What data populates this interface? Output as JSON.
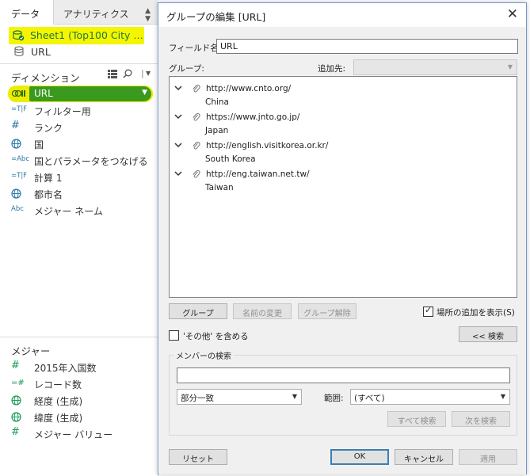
{
  "left_pane": {
    "tab_data": "データ",
    "tab_analytics": "アナリティクス",
    "datasources": [
      {
        "label": "Sheet1 (Top100 City …"
      },
      {
        "label": "URL"
      }
    ],
    "dimensions_header": "ディメンション",
    "dimensions": [
      {
        "icon": "url-field-icon",
        "label": "URL"
      },
      {
        "icon": "calculated-string-icon",
        "label": "フィルター用"
      },
      {
        "icon": "hash-icon",
        "label": "ランク"
      },
      {
        "icon": "globe-icon",
        "label": "国"
      },
      {
        "icon": "calculated-abc-icon",
        "label": "国とパラメータをつなげる"
      },
      {
        "icon": "calculated-string-icon",
        "label": "計算 1"
      },
      {
        "icon": "globe-icon",
        "label": "都市名"
      },
      {
        "icon": "abc-icon",
        "label": "メジャー ネーム"
      }
    ],
    "measures_header": "メジャー",
    "measures": [
      {
        "icon": "hash-icon",
        "label": "2015年入国数"
      },
      {
        "icon": "calculated-number-icon",
        "label": "レコード数"
      },
      {
        "icon": "globe-icon",
        "label": "経度 (生成)"
      },
      {
        "icon": "globe-icon",
        "label": "緯度 (生成)"
      },
      {
        "icon": "hash-icon",
        "label": "メジャー バリュー"
      }
    ],
    "icon_glyphs": {
      "abc": "Abc",
      "calc_string": "=T|F",
      "calc_abc": "=Abc",
      "calc_number": "=#",
      "hash": "#"
    }
  },
  "dialog": {
    "title": "グループの編集 [URL]",
    "field_name_label": "フィールド名:",
    "field_name_value": "URL",
    "group_label": "グループ:",
    "add_to_label": "追加先:",
    "add_to_value": "",
    "groups": [
      {
        "label": "http://www.cnto.org/",
        "members": [
          "China"
        ]
      },
      {
        "label": "https://www.jnto.go.jp/",
        "members": [
          "Japan"
        ]
      },
      {
        "label": "http://english.visitkorea.or.kr/",
        "members": [
          "South Korea"
        ]
      },
      {
        "label": "http://eng.taiwan.net.tw/",
        "members": [
          "Taiwan"
        ]
      }
    ],
    "buttons": {
      "group": "グループ",
      "rename": "名前の変更",
      "ungroup": "グループ解除",
      "find_toggle": "<< 検索",
      "find_all": "すべて検索",
      "find_next": "次を検索",
      "reset": "リセット",
      "ok": "OK",
      "cancel": "キャンセル",
      "apply": "適用"
    },
    "show_location_label": "場所の追加を表示(S)",
    "show_location_checked": true,
    "include_other_label": "'その他' を含める",
    "include_other_checked": false,
    "member_search_label": "メンバーの検索",
    "search_value": "",
    "match_mode_value": "部分一致",
    "range_label": "範囲:",
    "range_value": "(すべて)"
  }
}
